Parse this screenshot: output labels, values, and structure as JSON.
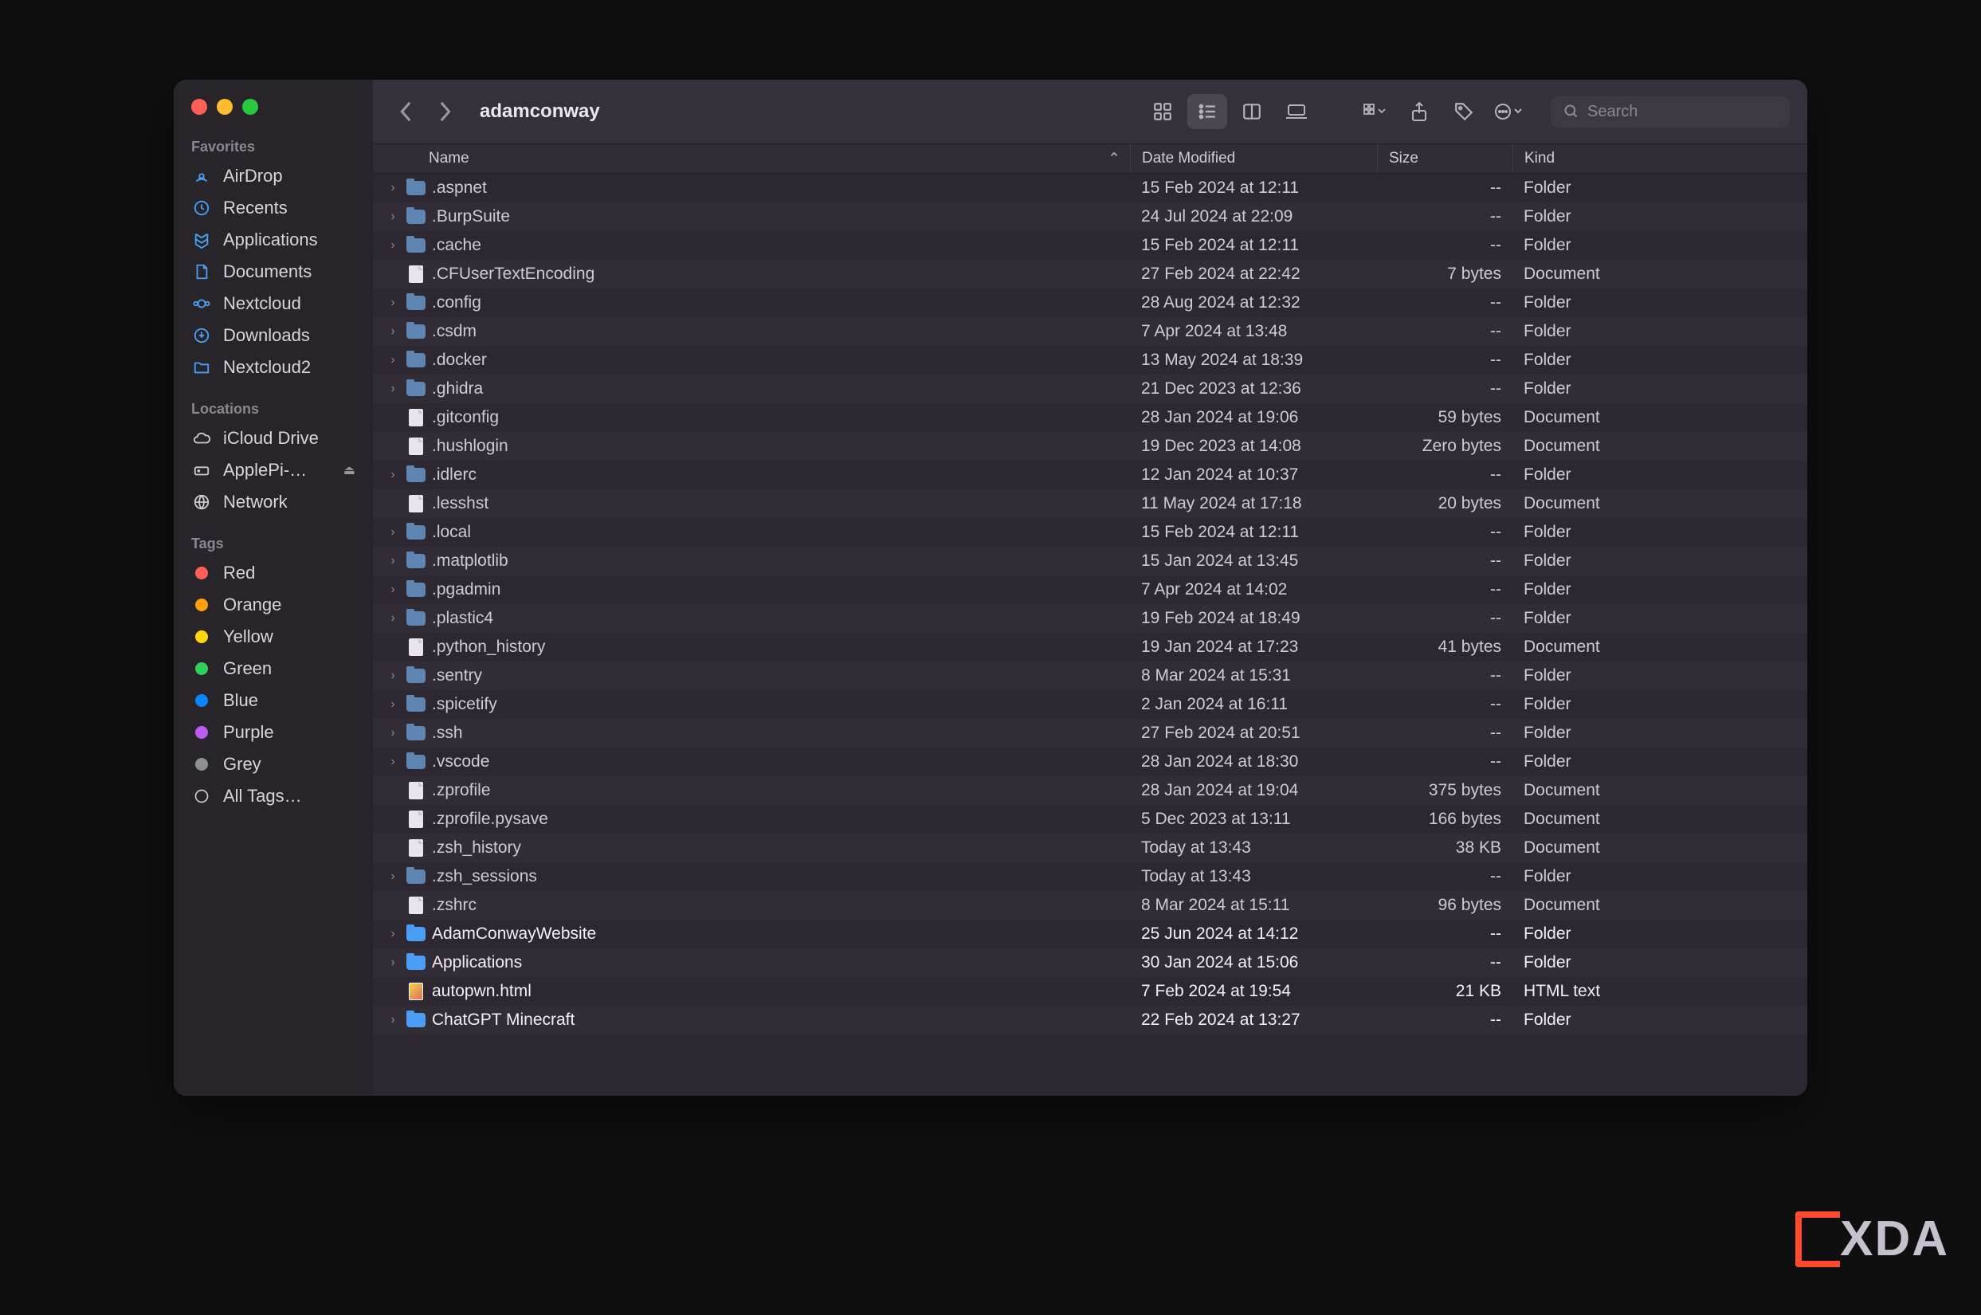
{
  "window": {
    "title": "adamconway"
  },
  "search": {
    "placeholder": "Search"
  },
  "sidebar": {
    "favorites_label": "Favorites",
    "locations_label": "Locations",
    "tags_label": "Tags",
    "favorites": [
      {
        "label": "AirDrop",
        "icon": "airdrop"
      },
      {
        "label": "Recents",
        "icon": "clock"
      },
      {
        "label": "Applications",
        "icon": "apps"
      },
      {
        "label": "Documents",
        "icon": "doc"
      },
      {
        "label": "Nextcloud",
        "icon": "nextcloud"
      },
      {
        "label": "Downloads",
        "icon": "download"
      },
      {
        "label": "Nextcloud2",
        "icon": "folder"
      }
    ],
    "locations": [
      {
        "label": "iCloud Drive",
        "icon": "icloud"
      },
      {
        "label": "ApplePi-…",
        "icon": "drive",
        "eject": true
      },
      {
        "label": "Network",
        "icon": "globe"
      }
    ],
    "tags": [
      {
        "label": "Red",
        "color": "#ff5f57"
      },
      {
        "label": "Orange",
        "color": "#ff9f0a"
      },
      {
        "label": "Yellow",
        "color": "#ffd60a"
      },
      {
        "label": "Green",
        "color": "#30d158"
      },
      {
        "label": "Blue",
        "color": "#0a84ff"
      },
      {
        "label": "Purple",
        "color": "#bf5af2"
      },
      {
        "label": "Grey",
        "color": "#8e8e93"
      }
    ],
    "all_tags": "All Tags…"
  },
  "columns": {
    "name": "Name",
    "date": "Date Modified",
    "size": "Size",
    "kind": "Kind"
  },
  "files": [
    {
      "name": ".aspnet",
      "date": "15 Feb 2024 at 12:11",
      "size": "--",
      "kind": "Folder",
      "type": "folder",
      "exp": true
    },
    {
      "name": ".BurpSuite",
      "date": "24 Jul 2024 at 22:09",
      "size": "--",
      "kind": "Folder",
      "type": "folder",
      "exp": true
    },
    {
      "name": ".cache",
      "date": "15 Feb 2024 at 12:11",
      "size": "--",
      "kind": "Folder",
      "type": "folder",
      "exp": true
    },
    {
      "name": ".CFUserTextEncoding",
      "date": "27 Feb 2024 at 22:42",
      "size": "7 bytes",
      "kind": "Document",
      "type": "doc"
    },
    {
      "name": ".config",
      "date": "28 Aug 2024 at 12:32",
      "size": "--",
      "kind": "Folder",
      "type": "folder",
      "exp": true
    },
    {
      "name": ".csdm",
      "date": "7 Apr 2024 at 13:48",
      "size": "--",
      "kind": "Folder",
      "type": "folder",
      "exp": true
    },
    {
      "name": ".docker",
      "date": "13 May 2024 at 18:39",
      "size": "--",
      "kind": "Folder",
      "type": "folder",
      "exp": true
    },
    {
      "name": ".ghidra",
      "date": "21 Dec 2023 at 12:36",
      "size": "--",
      "kind": "Folder",
      "type": "folder",
      "exp": true
    },
    {
      "name": ".gitconfig",
      "date": "28 Jan 2024 at 19:06",
      "size": "59 bytes",
      "kind": "Document",
      "type": "doc"
    },
    {
      "name": ".hushlogin",
      "date": "19 Dec 2023 at 14:08",
      "size": "Zero bytes",
      "kind": "Document",
      "type": "doc"
    },
    {
      "name": ".idlerc",
      "date": "12 Jan 2024 at 10:37",
      "size": "--",
      "kind": "Folder",
      "type": "folder",
      "exp": true
    },
    {
      "name": ".lesshst",
      "date": "11 May 2024 at 17:18",
      "size": "20 bytes",
      "kind": "Document",
      "type": "doc"
    },
    {
      "name": ".local",
      "date": "15 Feb 2024 at 12:11",
      "size": "--",
      "kind": "Folder",
      "type": "folder",
      "exp": true
    },
    {
      "name": ".matplotlib",
      "date": "15 Jan 2024 at 13:45",
      "size": "--",
      "kind": "Folder",
      "type": "folder",
      "exp": true
    },
    {
      "name": ".pgadmin",
      "date": "7 Apr 2024 at 14:02",
      "size": "--",
      "kind": "Folder",
      "type": "folder",
      "exp": true
    },
    {
      "name": ".plastic4",
      "date": "19 Feb 2024 at 18:49",
      "size": "--",
      "kind": "Folder",
      "type": "folder",
      "exp": true
    },
    {
      "name": ".python_history",
      "date": "19 Jan 2024 at 17:23",
      "size": "41 bytes",
      "kind": "Document",
      "type": "doc"
    },
    {
      "name": ".sentry",
      "date": "8 Mar 2024 at 15:31",
      "size": "--",
      "kind": "Folder",
      "type": "folder",
      "exp": true
    },
    {
      "name": ".spicetify",
      "date": "2 Jan 2024 at 16:11",
      "size": "--",
      "kind": "Folder",
      "type": "folder",
      "exp": true
    },
    {
      "name": ".ssh",
      "date": "27 Feb 2024 at 20:51",
      "size": "--",
      "kind": "Folder",
      "type": "folder",
      "exp": true
    },
    {
      "name": ".vscode",
      "date": "28 Jan 2024 at 18:30",
      "size": "--",
      "kind": "Folder",
      "type": "folder",
      "exp": true
    },
    {
      "name": ".zprofile",
      "date": "28 Jan 2024 at 19:04",
      "size": "375 bytes",
      "kind": "Document",
      "type": "doc"
    },
    {
      "name": ".zprofile.pysave",
      "date": "5 Dec 2023 at 13:11",
      "size": "166 bytes",
      "kind": "Document",
      "type": "doc"
    },
    {
      "name": ".zsh_history",
      "date": "Today at 13:43",
      "size": "38 KB",
      "kind": "Document",
      "type": "doc"
    },
    {
      "name": ".zsh_sessions",
      "date": "Today at 13:43",
      "size": "--",
      "kind": "Folder",
      "type": "folder",
      "exp": true
    },
    {
      "name": ".zshrc",
      "date": "8 Mar 2024 at 15:11",
      "size": "96 bytes",
      "kind": "Document",
      "type": "doc"
    },
    {
      "name": "AdamConwayWebsite",
      "date": "25 Jun 2024 at 14:12",
      "size": "--",
      "kind": "Folder",
      "type": "folder",
      "exp": true,
      "bright": true
    },
    {
      "name": "Applications",
      "date": "30 Jan 2024 at 15:06",
      "size": "--",
      "kind": "Folder",
      "type": "folder",
      "exp": true,
      "bright": true
    },
    {
      "name": "autopwn.html",
      "date": "7 Feb 2024 at 19:54",
      "size": "21 KB",
      "kind": "HTML text",
      "type": "html",
      "bright": true
    },
    {
      "name": "ChatGPT Minecraft",
      "date": "22 Feb 2024 at 13:27",
      "size": "--",
      "kind": "Folder",
      "type": "folder",
      "exp": true,
      "bright": true
    }
  ],
  "watermark": "XDA"
}
